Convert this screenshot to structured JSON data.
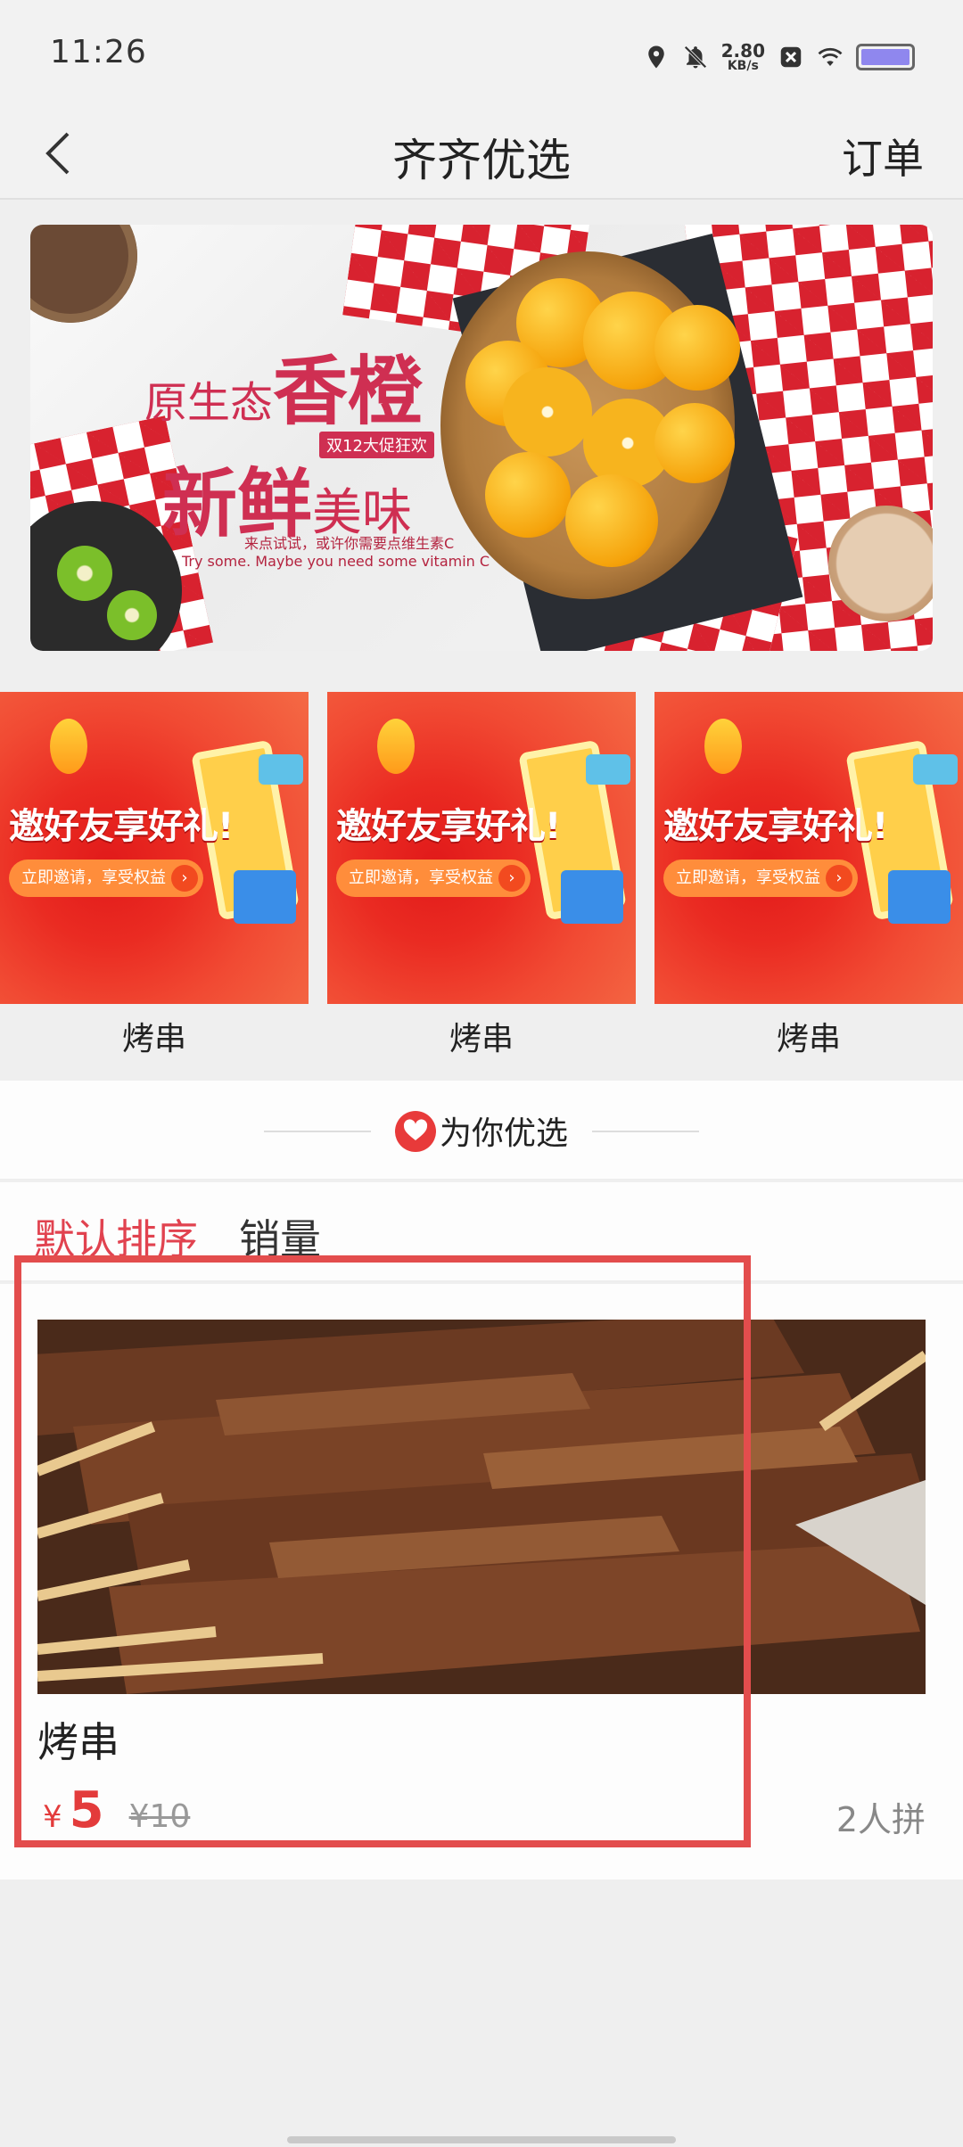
{
  "status_bar": {
    "time": "11:26",
    "net_speed_value": "2.80",
    "net_speed_unit": "KB/s",
    "icons": [
      "location-icon",
      "mute-icon",
      "net-speed",
      "close-badge-icon",
      "wifi-icon",
      "battery-icon"
    ]
  },
  "header": {
    "title": "齐齐优选",
    "right_action": "订单",
    "back_icon": "chevron-left-icon"
  },
  "banner": {
    "line1_small": "原生态",
    "line1_big": "香橙",
    "line2_big": "新鲜",
    "line2_small": "美味",
    "tag": "双12大促狂欢",
    "sub1": "来点试试，或许你需要点维生素C",
    "sub2": "Try some. Maybe you need some vitamin C"
  },
  "promos": [
    {
      "headline": "邀好友享好礼!",
      "pill": "立即邀请，享受权益",
      "label": "烤串"
    },
    {
      "headline": "邀好友享好礼!",
      "pill": "立即邀请，享受权益",
      "label": "烤串"
    },
    {
      "headline": "邀好友享好礼!",
      "pill": "立即邀请，享受权益",
      "label": "烤串"
    }
  ],
  "section": {
    "title": "为你优选"
  },
  "sort_tabs": {
    "active": "默认排序",
    "inactive": "销量"
  },
  "product": {
    "name": "烤串",
    "currency": "¥",
    "price": "5",
    "original_price": "¥10",
    "group_count": "2人拼"
  },
  "colors": {
    "accent": "#e1424f",
    "price": "#e33b3b",
    "highlight": "#e34d4d"
  }
}
